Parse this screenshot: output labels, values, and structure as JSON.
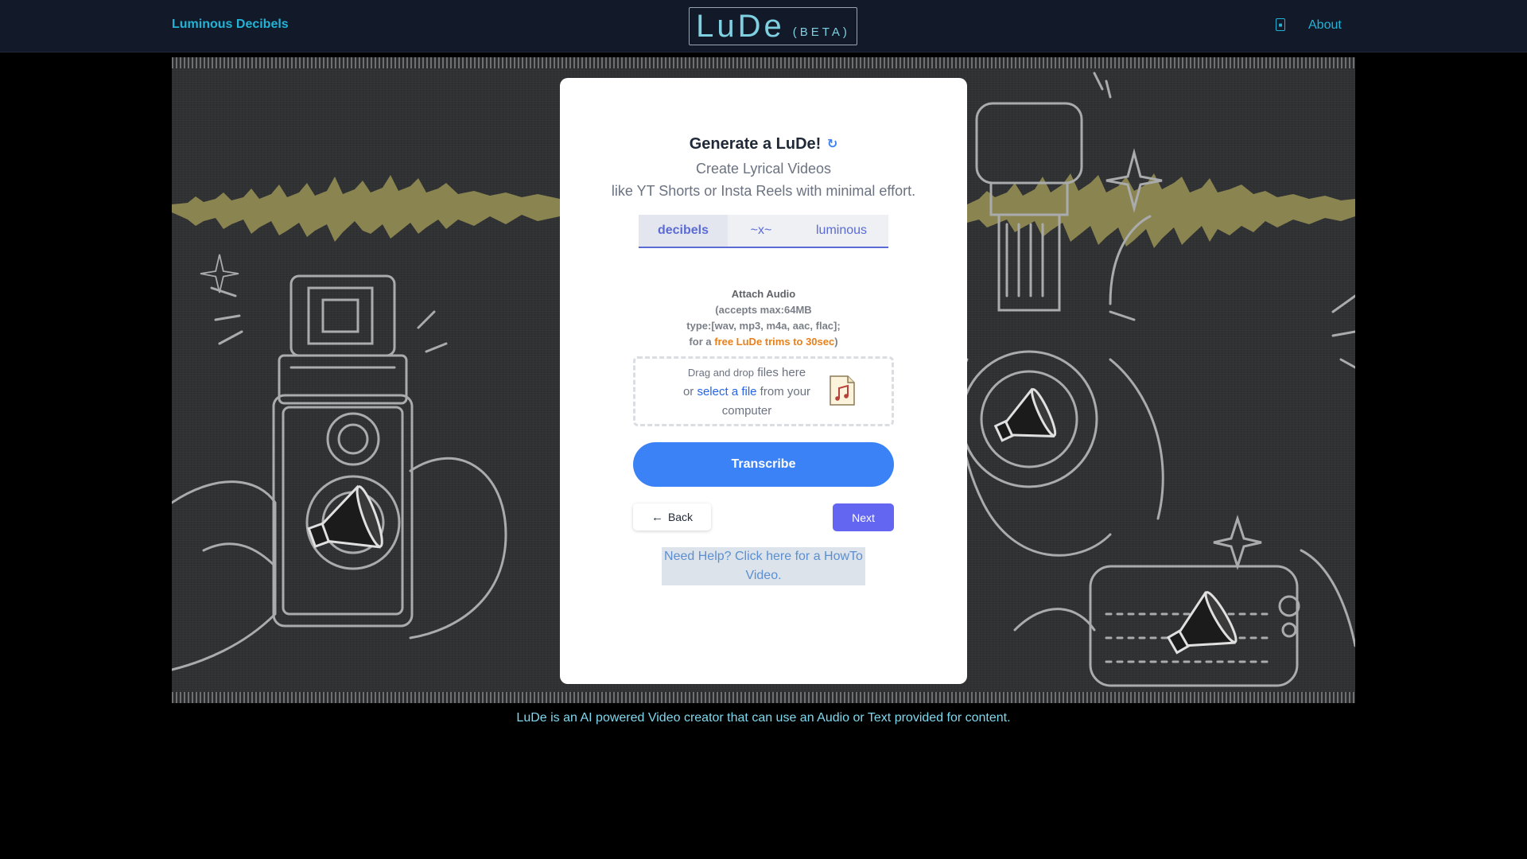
{
  "header": {
    "brand": "Luminous Decibels",
    "logo": "LuDe",
    "logo_tag": "(BETA)",
    "icon": "theme-icon",
    "about": "About"
  },
  "card": {
    "title": "Generate a LuDe!",
    "title_icon": "↻",
    "subtitle_1": "Create Lyrical Videos",
    "subtitle_2": "like YT Shorts or Insta Reels with minimal effort.",
    "tabs": [
      {
        "label": "decibels",
        "active": true
      },
      {
        "label": "~x~",
        "active": false
      },
      {
        "label": "luminous",
        "active": false
      }
    ],
    "attach": {
      "title": "Attach Audio",
      "line_1": "(accepts max:64MB",
      "line_2": "type:[wav, mp3, m4a, aac, flac];",
      "line_3_prefix": "for a ",
      "line_3_highlight": "free LuDe trims to 30sec",
      "line_3_suffix": ")"
    },
    "dropzone": {
      "drag_prefix": "Drag and drop",
      "drag_suffix": " files here",
      "or": "or ",
      "select_link": "select a file",
      "from": " from your",
      "computer": "computer",
      "icon": "audio-file-icon"
    },
    "transcribe": "Transcribe",
    "back": "Back",
    "back_icon": "←",
    "next": "Next",
    "help": "Need Help? Click here for a HowTo Video."
  },
  "footer": {
    "text": "LuDe is an AI powered Video creator that can use an Audio or Text provided for content."
  },
  "colors": {
    "nav_bg": "#121a2a",
    "accent_cyan": "#22b3d6",
    "primary_blue": "#3b82f6",
    "indigo": "#6366f1",
    "highlight_orange": "#e8801a",
    "waveform": "#8a8450"
  }
}
